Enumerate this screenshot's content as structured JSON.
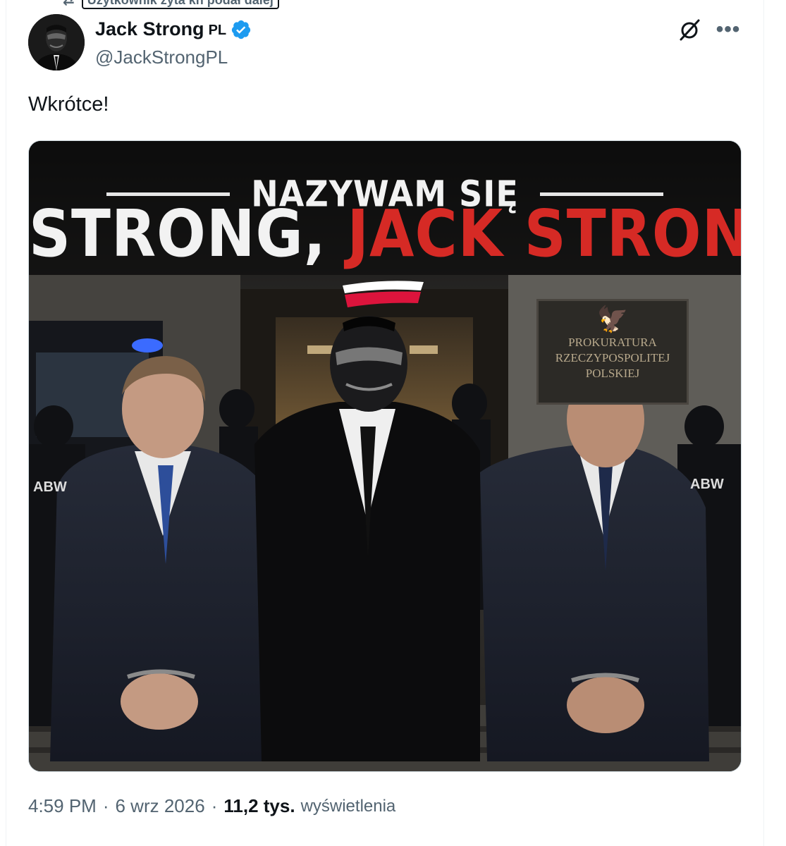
{
  "repost": {
    "icon": "repost-icon",
    "text": "Użytkownik zyta kh podał dalej"
  },
  "author": {
    "display_name": "Jack Strong",
    "name_suffix": "PL",
    "handle": "@JackStrongPL",
    "verified": true,
    "verified_color": "#1d9bf0",
    "avatar": "masked-man-avatar"
  },
  "actions": {
    "grok_icon": "grok-icon",
    "more_icon": "more-icon",
    "more_glyph": "•••"
  },
  "tweet": {
    "text": "Wkrótce!"
  },
  "media": {
    "headline_small": "NAZYWAM SIĘ",
    "headline_part1": "STRONG,",
    "headline_part2": "JACK STRONG",
    "plaque_line1": "PROKURATURA",
    "plaque_line2": "RZECZYPOSPOLITEJ",
    "plaque_line3": "POLSKIEJ",
    "guard_label": "ABW",
    "colors": {
      "headline_white": "#f2f2f2",
      "headline_red": "#d62a25",
      "flag_white": "#ffffff",
      "flag_red": "#dc143c"
    }
  },
  "footer": {
    "time": "4:59 PM",
    "separator": "·",
    "date": "6 wrz 2026",
    "views_count": "11,2 tys.",
    "views_label": "wyświetlenia"
  }
}
